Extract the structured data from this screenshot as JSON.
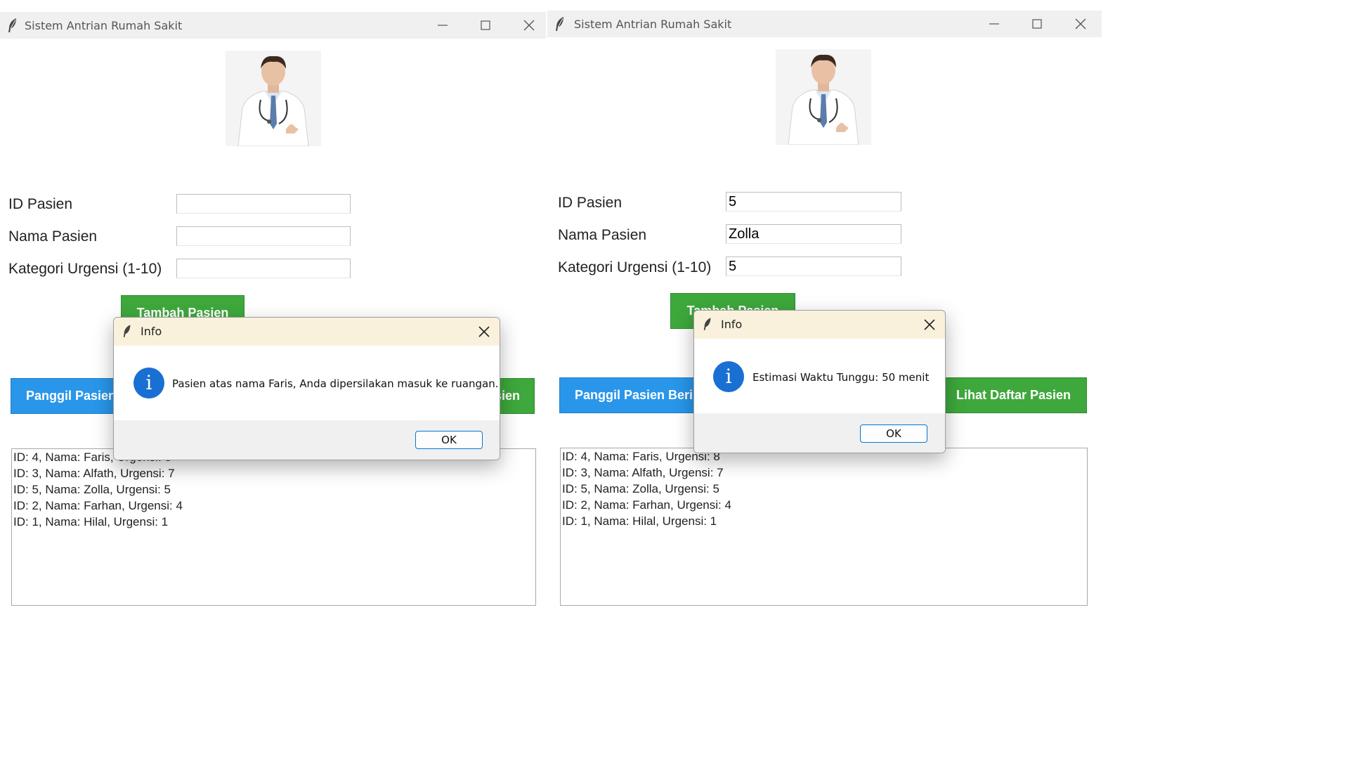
{
  "left": {
    "window_title": "Sistem Antrian Rumah Sakit",
    "labels": {
      "id": "ID Pasien",
      "nama": "Nama Pasien",
      "kategori": "Kategori Urgensi (1-10)"
    },
    "fields": {
      "id": "",
      "nama": "",
      "kategori": ""
    },
    "buttons": {
      "tambah": "Tambah Pasien",
      "panggil": "Panggil Pasien Berikutnya",
      "lihat": "Lihat Daftar Pasien"
    },
    "queue": [
      "ID: 4, Nama: Faris, Urgensi: 8",
      "ID: 3, Nama: Alfath, Urgensi: 7",
      "ID: 5, Nama: Zolla, Urgensi: 5",
      "ID: 2, Nama: Farhan, Urgensi: 4",
      "ID: 1, Nama: Hilal, Urgensi: 1"
    ],
    "dialog": {
      "title": "Info",
      "message": "Pasien atas nama Faris, Anda dipersilakan masuk ke ruangan.",
      "ok": "OK"
    }
  },
  "right": {
    "window_title": "Sistem Antrian Rumah Sakit",
    "labels": {
      "id": "ID Pasien",
      "nama": "Nama Pasien",
      "kategori": "Kategori Urgensi (1-10)"
    },
    "fields": {
      "id": "5",
      "nama": "Zolla",
      "kategori": "5"
    },
    "buttons": {
      "tambah": "Tambah Pasien",
      "panggil": "Panggil Pasien Berikutnya",
      "lihat": "Lihat Daftar Pasien"
    },
    "queue": [
      "ID: 4, Nama: Faris, Urgensi: 8",
      "ID: 3, Nama: Alfath, Urgensi: 7",
      "ID: 5, Nama: Zolla, Urgensi: 5",
      "ID: 2, Nama: Farhan, Urgensi: 4",
      "ID: 1, Nama: Hilal, Urgensi: 1"
    ],
    "dialog": {
      "title": "Info",
      "message": "Estimasi Waktu Tunggu: 50 menit",
      "ok": "OK"
    }
  },
  "icons": {
    "app": "feather-icon",
    "info": "info-icon",
    "minimize": "minimize-icon",
    "maximize": "maximize-icon",
    "close": "close-icon"
  },
  "colors": {
    "green_button": "#3ea83c",
    "blue_button": "#2996ea",
    "info_icon": "#1a6fd3",
    "dialog_title_bg": "#f9f1dc"
  }
}
